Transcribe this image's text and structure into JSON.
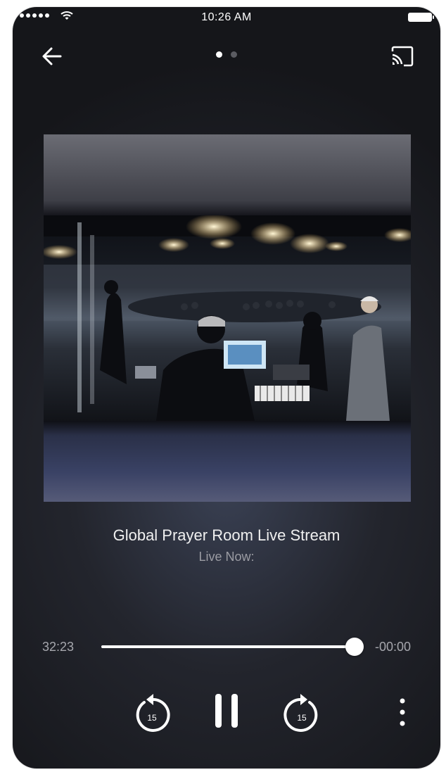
{
  "status_bar": {
    "time": "10:26 AM"
  },
  "nav": {
    "page_count": 2,
    "active_page": 1
  },
  "now_playing": {
    "title": "Global Prayer Room Live Stream",
    "subtitle": "Live Now:"
  },
  "progress": {
    "elapsed": "32:23",
    "remaining": "-00:00",
    "fraction": 1.0
  },
  "controls": {
    "skip_back_seconds": "15",
    "skip_forward_seconds": "15"
  },
  "icons": {
    "back": "arrow-left-icon",
    "cast": "cast-icon",
    "rewind": "rewind-15-icon",
    "pause": "pause-icon",
    "forward": "forward-15-icon",
    "more": "more-vertical-icon"
  },
  "colors": {
    "accent": "#ffffff",
    "dot_active": "#ffffff",
    "dot_inactive": "#5b5c62",
    "muted_text": "#9b9ca3"
  }
}
